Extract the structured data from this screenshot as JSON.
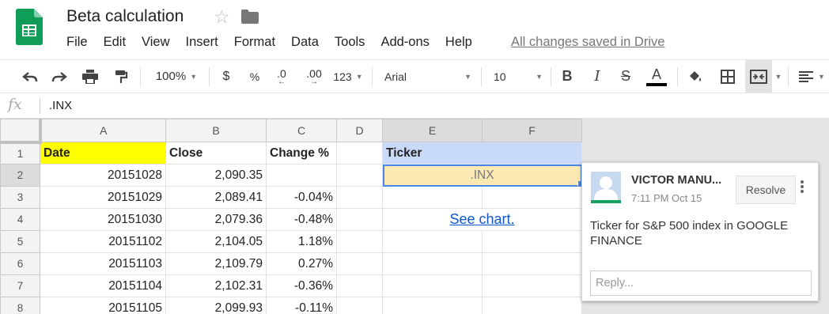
{
  "app": {
    "title": "Beta calculation",
    "save_status": "All changes saved in Drive",
    "icons": {
      "logo": "sheets-logo-icon",
      "star": "star-icon",
      "folder": "folder-icon"
    }
  },
  "menu": [
    "File",
    "Edit",
    "View",
    "Insert",
    "Format",
    "Data",
    "Tools",
    "Add-ons",
    "Help"
  ],
  "toolbar": {
    "zoom": "100%",
    "currency": "$",
    "percent": "%",
    "decrease_decimal": ".0",
    "increase_decimal": ".00",
    "more_formats": "123",
    "font": "Arial",
    "font_size": "10",
    "bold": "B",
    "italic": "I",
    "strikethrough": "S",
    "text_color": "A",
    "text_color_value": "#000000"
  },
  "formula_bar": {
    "fx": "fx",
    "value": ".INX"
  },
  "sheet": {
    "columns": [
      "A",
      "B",
      "C",
      "D",
      "E",
      "F"
    ],
    "rows": [
      {
        "n": "1",
        "a": "Date",
        "b": "Close",
        "c": "Change %",
        "e": "Ticker"
      },
      {
        "n": "2",
        "a": "20151028",
        "b": "2,090.35",
        "c": "",
        "e": ".INX"
      },
      {
        "n": "3",
        "a": "20151029",
        "b": "2,089.41",
        "c": "-0.04%"
      },
      {
        "n": "4",
        "a": "20151030",
        "b": "2,079.36",
        "c": "-0.48%",
        "e": "See chart."
      },
      {
        "n": "5",
        "a": "20151102",
        "b": "2,104.05",
        "c": "1.18%"
      },
      {
        "n": "6",
        "a": "20151103",
        "b": "2,109.79",
        "c": "0.27%"
      },
      {
        "n": "7",
        "a": "20151104",
        "b": "2,102.31",
        "c": "-0.36%"
      },
      {
        "n": "8",
        "a": "20151105",
        "b": "2,099.93",
        "c": "-0.11%"
      }
    ],
    "colors": {
      "date_header_bg": "#ffff00",
      "ticker_header_bg": "#c9daf8",
      "selected_cell_bg": "#fce8b2",
      "link": "#1155cc"
    }
  },
  "comment": {
    "author": "VICTOR MANU...",
    "time": "7:11 PM Oct 15",
    "resolve_label": "Resolve",
    "text": "Ticker for S&P 500 index in GOOGLE FINANCE",
    "reply_placeholder": "Reply..."
  }
}
